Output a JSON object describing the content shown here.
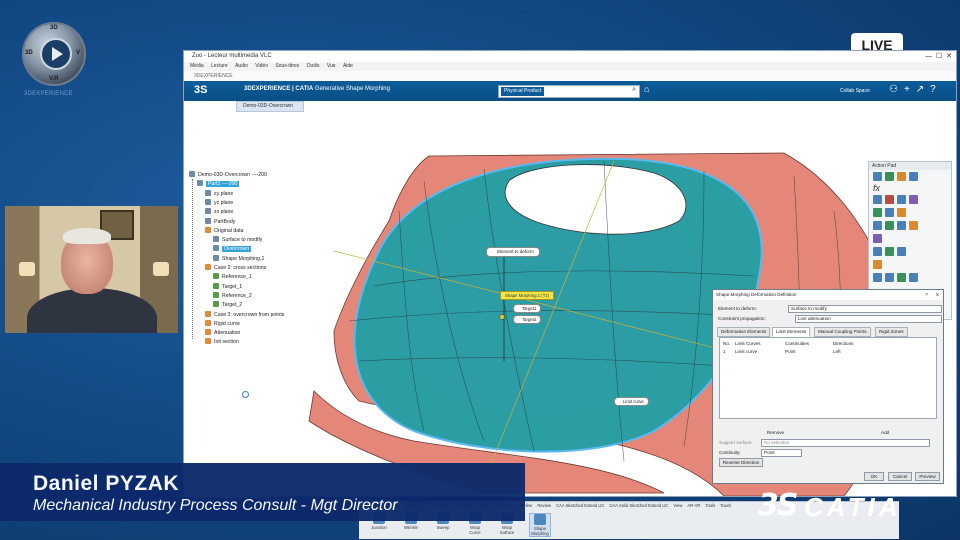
{
  "overlay": {
    "brand_caption": "3DEXPERIENCE",
    "logo_letters": {
      "top": "3D",
      "right": "V",
      "bottom": "V,R",
      "left": "3D"
    },
    "live_label": "LIVE",
    "presenter_name": "Daniel PYZAK",
    "presenter_role": "Mechanical Industry Process Consult - Mgt Director",
    "catia_symbol": "3S",
    "catia_wordmark": "CATIA"
  },
  "window": {
    "title": "Zuo - Lecteur multimedia VLC",
    "menu": [
      "Média",
      "Lecture",
      "Audio",
      "Vidéo",
      "Sous-titres",
      "Outils",
      "Vue",
      "Aide"
    ],
    "address": "3DEXPERIENCE",
    "app_title_bold": "3DEXPERIENCE | CATIA",
    "app_title_rest": " Generative Shape Morphing",
    "search_scope": "Physical Product",
    "collab_space": "Collab Space",
    "doc_tab": "Demo-03D-Overcrown"
  },
  "tree": [
    {
      "label": "Demo-03D-Overcrown ----200",
      "indent": 0,
      "kind": "root"
    },
    {
      "label": "Part1 ----200",
      "indent": 1,
      "kind": "sel"
    },
    {
      "label": "xy plane",
      "indent": 2,
      "kind": "plane"
    },
    {
      "label": "yz plane",
      "indent": 2,
      "kind": "plane"
    },
    {
      "label": "zx plane",
      "indent": 2,
      "kind": "plane"
    },
    {
      "label": "PartBody",
      "indent": 2,
      "kind": "body"
    },
    {
      "label": "Original data",
      "indent": 2,
      "kind": "set"
    },
    {
      "label": "Surface to modify",
      "indent": 3,
      "kind": "surf"
    },
    {
      "label": "Overcrown",
      "indent": 3,
      "kind": "sel"
    },
    {
      "label": "Shape Morphing.1",
      "indent": 3,
      "kind": "feat"
    },
    {
      "label": "Case 2: cross sections",
      "indent": 2,
      "kind": "set"
    },
    {
      "label": "Reference_1",
      "indent": 3,
      "kind": "curve"
    },
    {
      "label": "Target_1",
      "indent": 3,
      "kind": "curve"
    },
    {
      "label": "Reference_2",
      "indent": 3,
      "kind": "curve"
    },
    {
      "label": "Target_2",
      "indent": 3,
      "kind": "curve"
    },
    {
      "label": "Case 3: overcrown from points",
      "indent": 2,
      "kind": "set"
    },
    {
      "label": "Rigid curve",
      "indent": 2,
      "kind": "set"
    },
    {
      "label": "Attenuation",
      "indent": 2,
      "kind": "set"
    },
    {
      "label": "Init section",
      "indent": 2,
      "kind": "set"
    }
  ],
  "scene_labels": {
    "element_to_deform": "Element to deform",
    "shape_label": "Shape Morphing.1 (T1)",
    "target1": "Target1",
    "target2": "Target2",
    "limit_curve": "Limit curve"
  },
  "action_pad": {
    "title": "Action Pad",
    "fx": "fx"
  },
  "dialog": {
    "title": "Shape Morphing Deformation Definition",
    "help": "?",
    "close": "X",
    "element_label": "Element to deform:",
    "element_value": "Surface to modify",
    "constraint_label": "Constraint propagation:",
    "constraint_value": "Line attenuation",
    "tabs": [
      "Deformation Elements",
      "Limit Elements",
      "Manual Coupling Points",
      "Rigid Zones"
    ],
    "columns": [
      "No.",
      "Limit Curves",
      "Continuities",
      "Directions"
    ],
    "row": [
      "1",
      "Limit curve",
      "Point",
      "Left"
    ],
    "remove": "Remove",
    "add": "Add",
    "support_label": "Support surface:",
    "support_value": "No selection",
    "continuity_label": "Continuity:",
    "continuity_value": "Point",
    "reverse": "Reverse Direction",
    "ok": "OK",
    "cancel": "Cancel",
    "preview": "Preview"
  },
  "toolbar": {
    "tabs": [
      "Standard",
      "Essentials",
      "Morphing",
      "Wireframe",
      "Surface",
      "Volume",
      "Transform",
      "Refine",
      "Review",
      "CAA Sketched Extend UC",
      "CAA Solid Sketched Extend UC",
      "View",
      "AR-VR",
      "Tools",
      "Touch"
    ],
    "active_tab": 2,
    "tools": [
      "Junction",
      "Wrinkle",
      "Sweep",
      "Wrap Curve",
      "Wrap Surface",
      "Shape Morphing"
    ]
  },
  "colors": {
    "background": "#134a86",
    "catia_bar": "#0b5c99",
    "surface_pink": "#e58778",
    "surface_teal": "#2a9ea3",
    "banner": "#0c2a6b"
  }
}
